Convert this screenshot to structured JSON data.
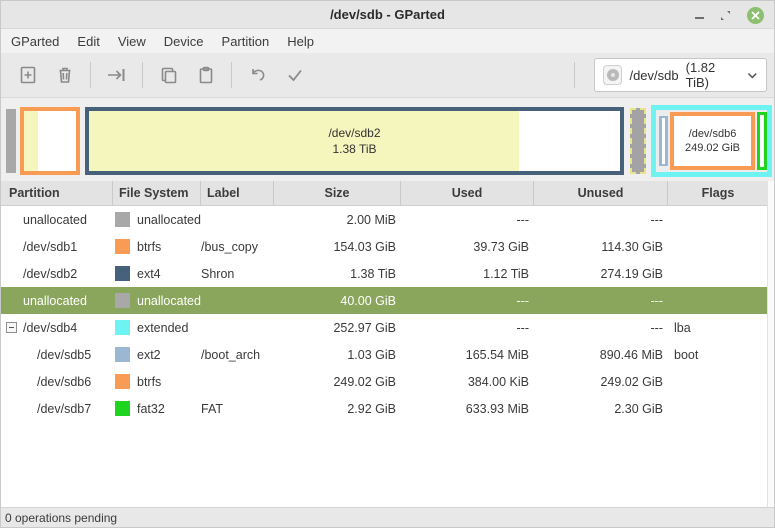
{
  "window": {
    "title": "/dev/sdb - GParted"
  },
  "menu": {
    "items": [
      "GParted",
      "Edit",
      "View",
      "Device",
      "Partition",
      "Help"
    ]
  },
  "toolbar": {
    "icons": [
      "new-partition-icon",
      "delete-partition-icon",
      "resize-move-icon",
      "copy-icon",
      "paste-icon",
      "undo-icon",
      "apply-icon"
    ],
    "device_selector": {
      "device": "/dev/sdb",
      "size": "(1.82 TiB)"
    }
  },
  "colors": {
    "selection_green": "#8aa55c",
    "unallocated_gray": "#a8a8a8",
    "btrfs_orange": "#f89b54",
    "ext4_slate": "#47617b",
    "extended_cyan": "#6ef2f2",
    "ext2_blue": "#9cb7d1",
    "fat32_green": "#1ed41e",
    "used_yellow": "#f5f5be",
    "close_button_green": "#8cbf6f"
  },
  "visual_bar": {
    "segments": [
      {
        "name": "unallocated",
        "color": "#a8a8a8"
      },
      {
        "name": "/dev/sdb1",
        "fs": "btrfs",
        "border": "#f89b54",
        "used_pct": 26
      },
      {
        "name": "/dev/sdb2",
        "fs": "ext4",
        "border": "#47617b",
        "used_pct": 81,
        "label_line1": "/dev/sdb2",
        "label_line2": "1.38 TiB"
      },
      {
        "name": "unallocated",
        "color": "#a8a8a8",
        "selected": true
      },
      {
        "name": "/dev/sdb4",
        "fs": "extended",
        "border": "#6ef2f2",
        "children": [
          {
            "name": "/dev/sdb5",
            "fs": "ext2",
            "color": "#9cb7d1"
          },
          {
            "name": "/dev/sdb6",
            "fs": "btrfs",
            "border": "#f89b54",
            "label_line1": "/dev/sdb6",
            "label_line2": "249.02 GiB"
          },
          {
            "name": "/dev/sdb7",
            "fs": "fat32",
            "border": "#1ed41e"
          }
        ]
      }
    ]
  },
  "table": {
    "columns": [
      "Partition",
      "File System",
      "Label",
      "Size",
      "Used",
      "Unused",
      "Flags"
    ],
    "rows": [
      {
        "partition": "unallocated",
        "fs": "unallocated",
        "fs_color": "#a8a8a8",
        "label": "",
        "size": "2.00 MiB",
        "used": "---",
        "unused": "---",
        "flags": ""
      },
      {
        "partition": "/dev/sdb1",
        "fs": "btrfs",
        "fs_color": "#f89b54",
        "label": "/bus_copy",
        "size": "154.03 GiB",
        "used": "39.73 GiB",
        "unused": "114.30 GiB",
        "flags": ""
      },
      {
        "partition": "/dev/sdb2",
        "fs": "ext4",
        "fs_color": "#47617b",
        "label": "Shron",
        "size": "1.38 TiB",
        "used": "1.12 TiB",
        "unused": "274.19 GiB",
        "flags": ""
      },
      {
        "partition": "unallocated",
        "fs": "unallocated",
        "fs_color": "#a8a8a8",
        "label": "",
        "size": "40.00 GiB",
        "used": "---",
        "unused": "---",
        "flags": ""
      },
      {
        "partition": "/dev/sdb4",
        "fs": "extended",
        "fs_color": "#6ef2f2",
        "label": "",
        "size": "252.97 GiB",
        "used": "---",
        "unused": "---",
        "flags": "lba"
      },
      {
        "partition": "/dev/sdb5",
        "fs": "ext2",
        "fs_color": "#9cb7d1",
        "label": "/boot_arch",
        "size": "1.03 GiB",
        "used": "165.54 MiB",
        "unused": "890.46 MiB",
        "flags": "boot"
      },
      {
        "partition": "/dev/sdb6",
        "fs": "btrfs",
        "fs_color": "#f89b54",
        "label": "",
        "size": "249.02 GiB",
        "used": "384.00 KiB",
        "unused": "249.02 GiB",
        "flags": ""
      },
      {
        "partition": "/dev/sdb7",
        "fs": "fat32",
        "fs_color": "#1ed41e",
        "label": "FAT",
        "size": "2.92 GiB",
        "used": "633.93 MiB",
        "unused": "2.30 GiB",
        "flags": ""
      }
    ]
  },
  "statusbar": {
    "text": "0 operations pending"
  }
}
